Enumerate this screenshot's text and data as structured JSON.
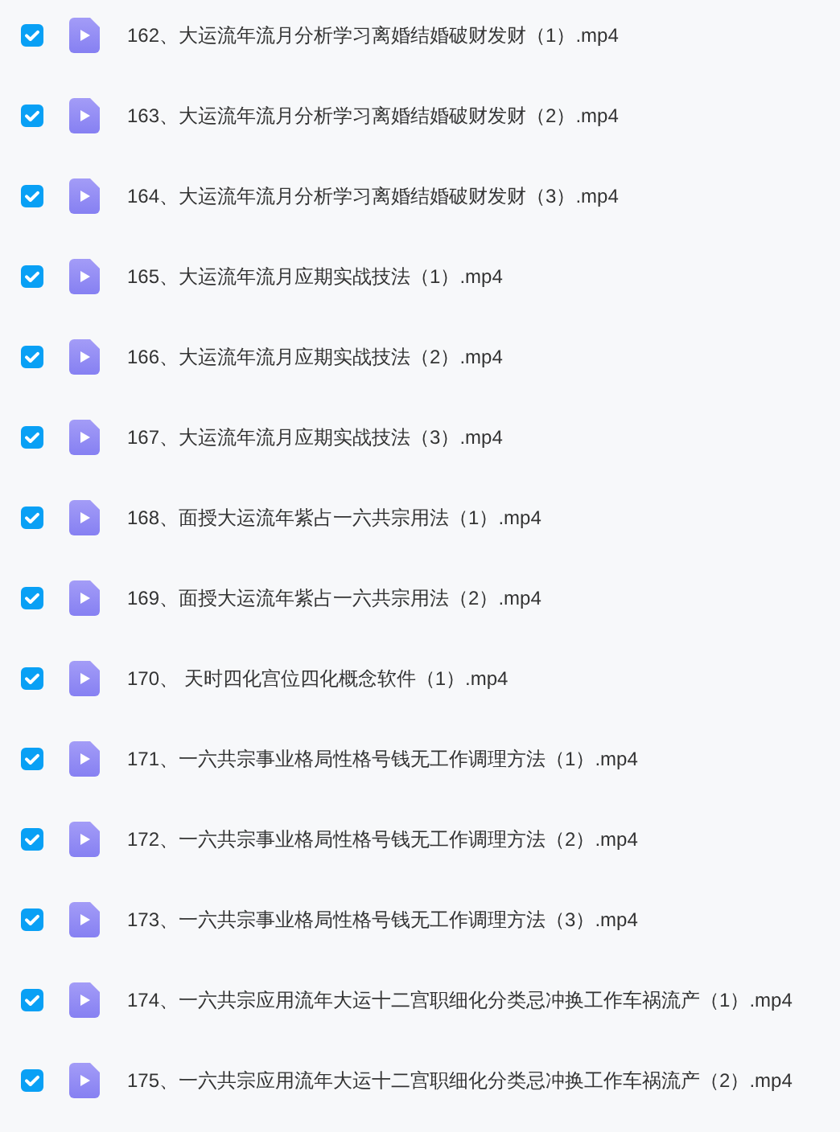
{
  "files": [
    {
      "name": "162、大运流年流月分析学习离婚结婚破财发财（1）.mp4",
      "checked": true
    },
    {
      "name": "163、大运流年流月分析学习离婚结婚破财发财（2）.mp4",
      "checked": true
    },
    {
      "name": "164、大运流年流月分析学习离婚结婚破财发财（3）.mp4",
      "checked": true
    },
    {
      "name": "165、大运流年流月应期实战技法（1）.mp4",
      "checked": true
    },
    {
      "name": "166、大运流年流月应期实战技法（2）.mp4",
      "checked": true
    },
    {
      "name": "167、大运流年流月应期实战技法（3）.mp4",
      "checked": true
    },
    {
      "name": "168、面授大运流年紫占一六共宗用法（1）.mp4",
      "checked": true
    },
    {
      "name": "169、面授大运流年紫占一六共宗用法（2）.mp4",
      "checked": true
    },
    {
      "name": "170、 天时四化宫位四化概念软件（1）.mp4",
      "checked": true
    },
    {
      "name": "171、一六共宗事业格局性格号钱无工作调理方法（1）.mp4",
      "checked": true
    },
    {
      "name": "172、一六共宗事业格局性格号钱无工作调理方法（2）.mp4",
      "checked": true
    },
    {
      "name": "173、一六共宗事业格局性格号钱无工作调理方法（3）.mp4",
      "checked": true
    },
    {
      "name": "174、一六共宗应用流年大运十二宫职细化分类忌冲换工作车祸流产（1）.mp4",
      "checked": true
    },
    {
      "name": "175、一六共宗应用流年大运十二宫职细化分类忌冲换工作车祸流产（2）.mp4",
      "checked": true
    }
  ]
}
